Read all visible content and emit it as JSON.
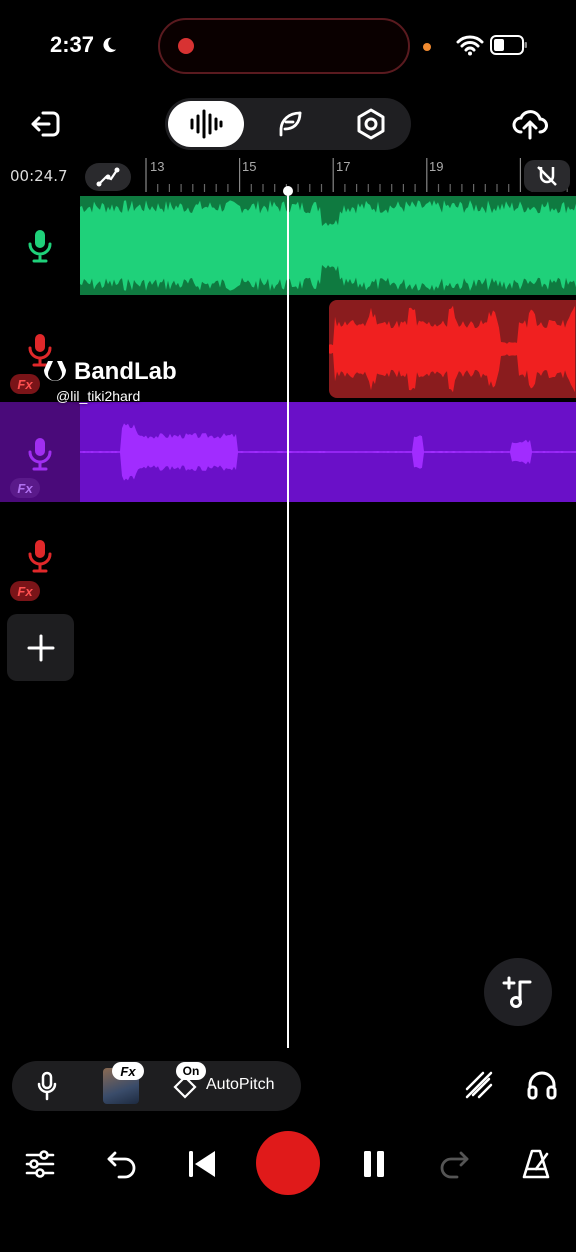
{
  "status_bar": {
    "time": "2:37",
    "icons": [
      "moon-icon",
      "wifi-icon",
      "battery-icon"
    ]
  },
  "top_toolbar": {
    "left": "exit-icon",
    "modes": [
      "waveform-icon",
      "feather-icon",
      "settings-hexagon-icon"
    ],
    "active_mode": 0,
    "right": "cloud-upload-icon"
  },
  "ruler": {
    "time_readout": "00:24.7",
    "bar_labels": [
      "13",
      "15",
      "17",
      "19"
    ]
  },
  "tracks": [
    {
      "name": "track-1",
      "color": "#1fd17a",
      "mic_color": "#2ad27a",
      "fx": false
    },
    {
      "name": "track-2",
      "color": "#f02020",
      "mic_color": "#e0282a",
      "fx": true
    },
    {
      "name": "track-3",
      "color": "#a12cff",
      "mic_color": "#a02ef0",
      "fx": true
    },
    {
      "name": "track-4",
      "color": "#e0282a",
      "mic_color": "#e0282a",
      "fx": true
    }
  ],
  "fx_label": "Fx",
  "watermark": {
    "brand": "BandLab",
    "user": "@lil_tiki2hard"
  },
  "bottom_controls": {
    "fx_chip": "Fx",
    "autopitch_state": "On",
    "autopitch_label": "AutoPitch"
  },
  "colors": {
    "accent_red": "#e01a1a",
    "green": "#1fd17a",
    "purple": "#a12cff"
  }
}
